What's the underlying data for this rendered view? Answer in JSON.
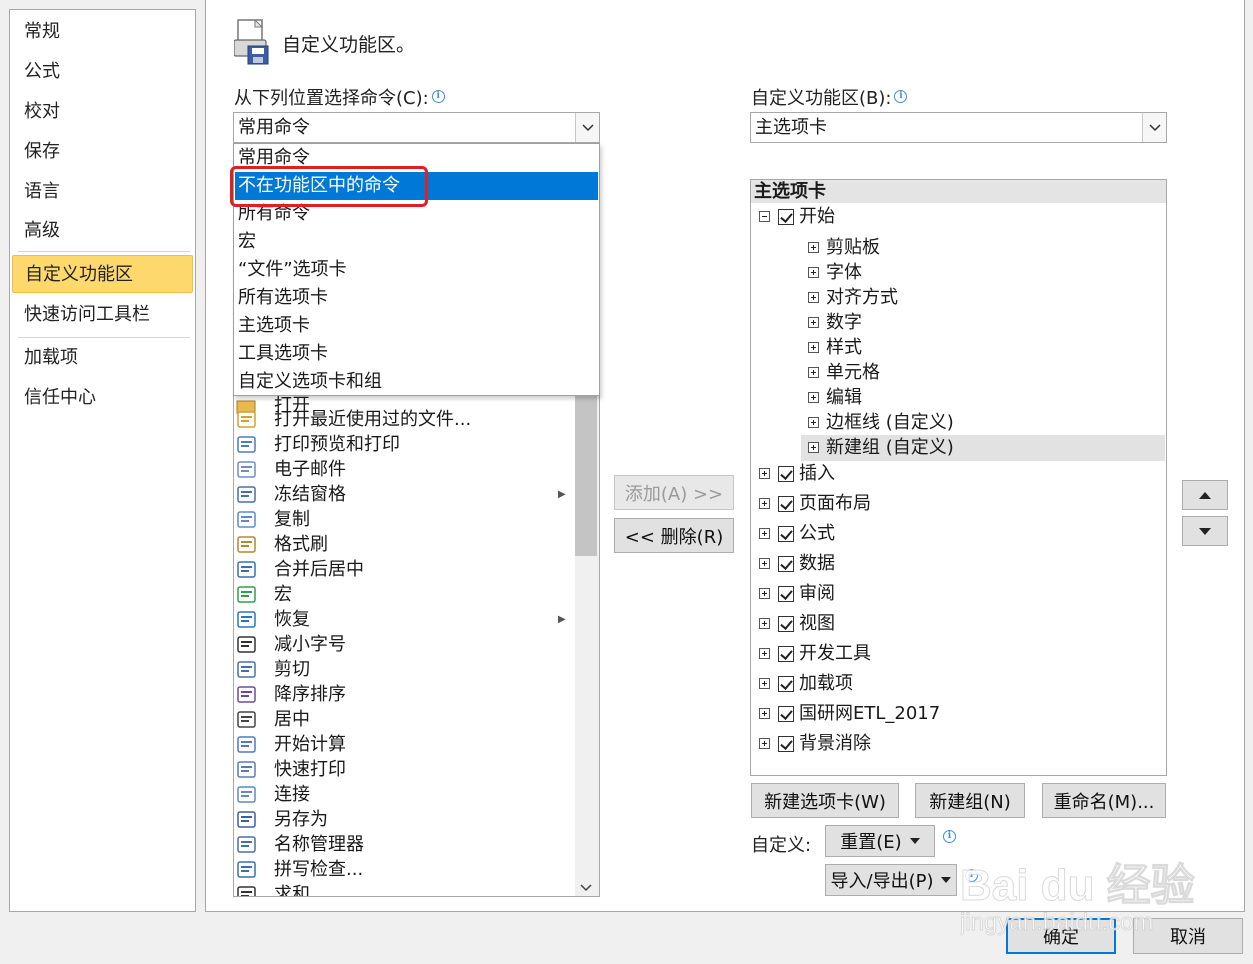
{
  "nav": {
    "items": [
      {
        "label": "常规"
      },
      {
        "label": "公式"
      },
      {
        "label": "校对"
      },
      {
        "label": "保存"
      },
      {
        "label": "语言"
      },
      {
        "label": "高级"
      },
      {
        "label": "自定义功能区",
        "selected": true
      },
      {
        "label": "快速访问工具栏"
      },
      {
        "label": "加载项"
      },
      {
        "label": "信任中心"
      }
    ]
  },
  "header": {
    "title": "自定义功能区。",
    "icon": "ribbon-customize-icon"
  },
  "left_pane": {
    "label": "从下列位置选择命令(C):",
    "combo_value": "常用命令",
    "dropdown_options": [
      "常用命令",
      "不在功能区中的命令",
      "所有命令",
      "宏",
      "“文件”选项卡",
      "所有选项卡",
      "主选项卡",
      "工具选项卡",
      "自定义选项卡和组"
    ],
    "highlighted_option": "不在功能区中的命令",
    "partial_item": "打开",
    "commands": [
      {
        "label": "打开最近使用过的文件...",
        "icon": "recent-files-icon"
      },
      {
        "label": "打印预览和打印",
        "icon": "print-preview-icon"
      },
      {
        "label": "电子邮件",
        "icon": "email-icon"
      },
      {
        "label": "冻结窗格",
        "icon": "freeze-panes-icon",
        "submenu": true
      },
      {
        "label": "复制",
        "icon": "copy-icon"
      },
      {
        "label": "格式刷",
        "icon": "format-painter-icon"
      },
      {
        "label": "合并后居中",
        "icon": "merge-center-icon"
      },
      {
        "label": "宏",
        "icon": "macro-icon"
      },
      {
        "label": "恢复",
        "icon": "redo-icon",
        "submenu": true
      },
      {
        "label": "减小字号",
        "icon": "decrease-font-icon"
      },
      {
        "label": "剪切",
        "icon": "cut-icon"
      },
      {
        "label": "降序排序",
        "icon": "sort-descending-icon"
      },
      {
        "label": "居中",
        "icon": "align-center-icon"
      },
      {
        "label": "开始计算",
        "icon": "calculate-icon"
      },
      {
        "label": "快速打印",
        "icon": "quick-print-icon"
      },
      {
        "label": "连接",
        "icon": "connections-icon"
      },
      {
        "label": "另存为",
        "icon": "save-as-icon"
      },
      {
        "label": "名称管理器",
        "icon": "name-manager-icon"
      },
      {
        "label": "拼写检查...",
        "icon": "spelling-icon"
      },
      {
        "label": "求和",
        "icon": "sum-icon"
      }
    ]
  },
  "middle": {
    "add_label": "添加(A) >>",
    "remove_label": "<< 删除(R)"
  },
  "right_pane": {
    "label": "自定义功能区(B):",
    "combo_value": "主选项卡",
    "tree_header": "主选项卡",
    "tree": [
      {
        "label": "开始",
        "level": 0,
        "expanded": true,
        "checked": true
      },
      {
        "label": "剪贴板",
        "level": 1
      },
      {
        "label": "字体",
        "level": 1
      },
      {
        "label": "对齐方式",
        "level": 1
      },
      {
        "label": "数字",
        "level": 1
      },
      {
        "label": "样式",
        "level": 1
      },
      {
        "label": "单元格",
        "level": 1
      },
      {
        "label": "编辑",
        "level": 1
      },
      {
        "label": "边框线 (自定义)",
        "level": 1
      },
      {
        "label": "新建组 (自定义)",
        "level": 1,
        "selected": true
      },
      {
        "label": "插入",
        "level": 0,
        "checked": true
      },
      {
        "label": "页面布局",
        "level": 0,
        "checked": true
      },
      {
        "label": "公式",
        "level": 0,
        "checked": true
      },
      {
        "label": "数据",
        "level": 0,
        "checked": true
      },
      {
        "label": "审阅",
        "level": 0,
        "checked": true
      },
      {
        "label": "视图",
        "level": 0,
        "checked": true
      },
      {
        "label": "开发工具",
        "level": 0,
        "checked": true
      },
      {
        "label": "加载项",
        "level": 0,
        "checked": true
      },
      {
        "label": "国研网ETL_2017",
        "level": 0,
        "checked": true
      },
      {
        "label": "背景消除",
        "level": 0,
        "checked": true
      }
    ],
    "new_tab_label": "新建选项卡(W)",
    "new_group_label": "新建组(N)",
    "rename_label": "重命名(M)...",
    "customize_label": "自定义:",
    "reset_label": "重置(E)",
    "import_export_label": "导入/导出(P)"
  },
  "footer": {
    "ok_label": "确定",
    "cancel_label": "取消"
  },
  "watermark": {
    "logo": "Bai du 经验",
    "url": "jingyan.baidu.com"
  },
  "colors": {
    "accent": "#0078d7",
    "nav_selected": "#fcd86d",
    "highlight_box": "#e02020"
  }
}
